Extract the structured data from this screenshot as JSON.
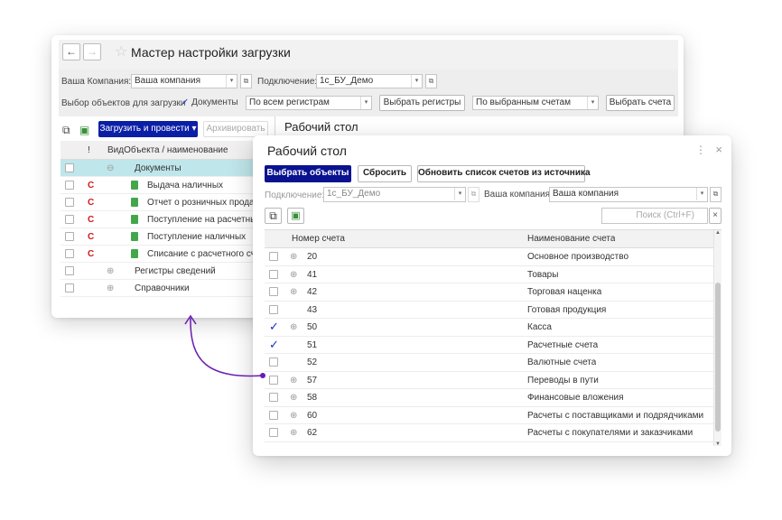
{
  "back_window": {
    "title": "Мастер настройки загрузки",
    "nav_back": "←",
    "nav_forward": "→",
    "company_label": "Ваша Компания:",
    "company_value": "Ваша компания",
    "connection_label": "Подключение:",
    "connection_value": "1с_БУ_Демо",
    "objects_label": "Выбор объектов для загрузки",
    "docs_check_label": "Документы",
    "registers_select": "По всем регистрам",
    "choose_registers_btn": "Выбрать регистры",
    "accounts_select": "По выбранным счетам",
    "choose_accounts_btn": "Выбрать счета",
    "load_btn": "Загрузить и провести",
    "archive_btn": "Архивировать",
    "tab_title": "Рабочий стол",
    "table": {
      "col_excl": "!",
      "col_name": "ВидОбъекта / наименование",
      "rows": [
        {
          "mark": "",
          "name": "Документы",
          "kind": "group-open",
          "selected": true
        },
        {
          "mark": "С",
          "name": "Выдача наличных",
          "kind": "doc"
        },
        {
          "mark": "С",
          "name": "Отчет о розничных продажах",
          "kind": "doc"
        },
        {
          "mark": "С",
          "name": "Поступление на расчетный счет",
          "kind": "doc"
        },
        {
          "mark": "С",
          "name": "Поступление наличных",
          "kind": "doc"
        },
        {
          "mark": "С",
          "name": "Списание с расчетного счета",
          "kind": "doc"
        },
        {
          "mark": "",
          "name": "Регистры сведений",
          "kind": "group"
        },
        {
          "mark": "",
          "name": "Справочники",
          "kind": "group"
        }
      ]
    }
  },
  "front_window": {
    "title": "Рабочий стол",
    "menu_icon": "⋮",
    "close_icon": "×",
    "select_objects_btn": "Выбрать объекты",
    "reset_btn": "Сбросить",
    "refresh_btn": "Обновить список счетов из источника",
    "connection_label": "Подключение:",
    "connection_value": "1с_БУ_Демо",
    "company_label": "Ваша компания:",
    "company_value": "Ваша компания",
    "search_placeholder": "Поиск (Ctrl+F)",
    "table": {
      "col_account": "Номер счета",
      "col_name": "Наименование счета",
      "rows": [
        {
          "num": "20",
          "name": "Основное производство",
          "checked": false,
          "expand": true
        },
        {
          "num": "41",
          "name": "Товары",
          "checked": false,
          "expand": true
        },
        {
          "num": "42",
          "name": "Торговая наценка",
          "checked": false,
          "expand": true
        },
        {
          "num": "43",
          "name": "Готовая продукция",
          "checked": false,
          "expand": false
        },
        {
          "num": "50",
          "name": "Касса",
          "checked": true,
          "expand": true
        },
        {
          "num": "51",
          "name": "Расчетные счета",
          "checked": true,
          "expand": false
        },
        {
          "num": "52",
          "name": "Валютные счета",
          "checked": false,
          "expand": false
        },
        {
          "num": "57",
          "name": "Переводы в пути",
          "checked": false,
          "expand": true
        },
        {
          "num": "58",
          "name": "Финансовые вложения",
          "checked": false,
          "expand": true
        },
        {
          "num": "60",
          "name": "Расчеты с поставщиками и подрядчиками",
          "checked": false,
          "expand": true
        },
        {
          "num": "62",
          "name": "Расчеты с покупателями и заказчиками",
          "checked": false,
          "expand": true
        }
      ]
    }
  },
  "colors": {
    "primary_button": "#0b1fa6",
    "selected_row": "#bfe6ea",
    "arrow": "#6a1bb3",
    "check_blue": "#1530c8",
    "doc_red": "#d01a1a"
  }
}
